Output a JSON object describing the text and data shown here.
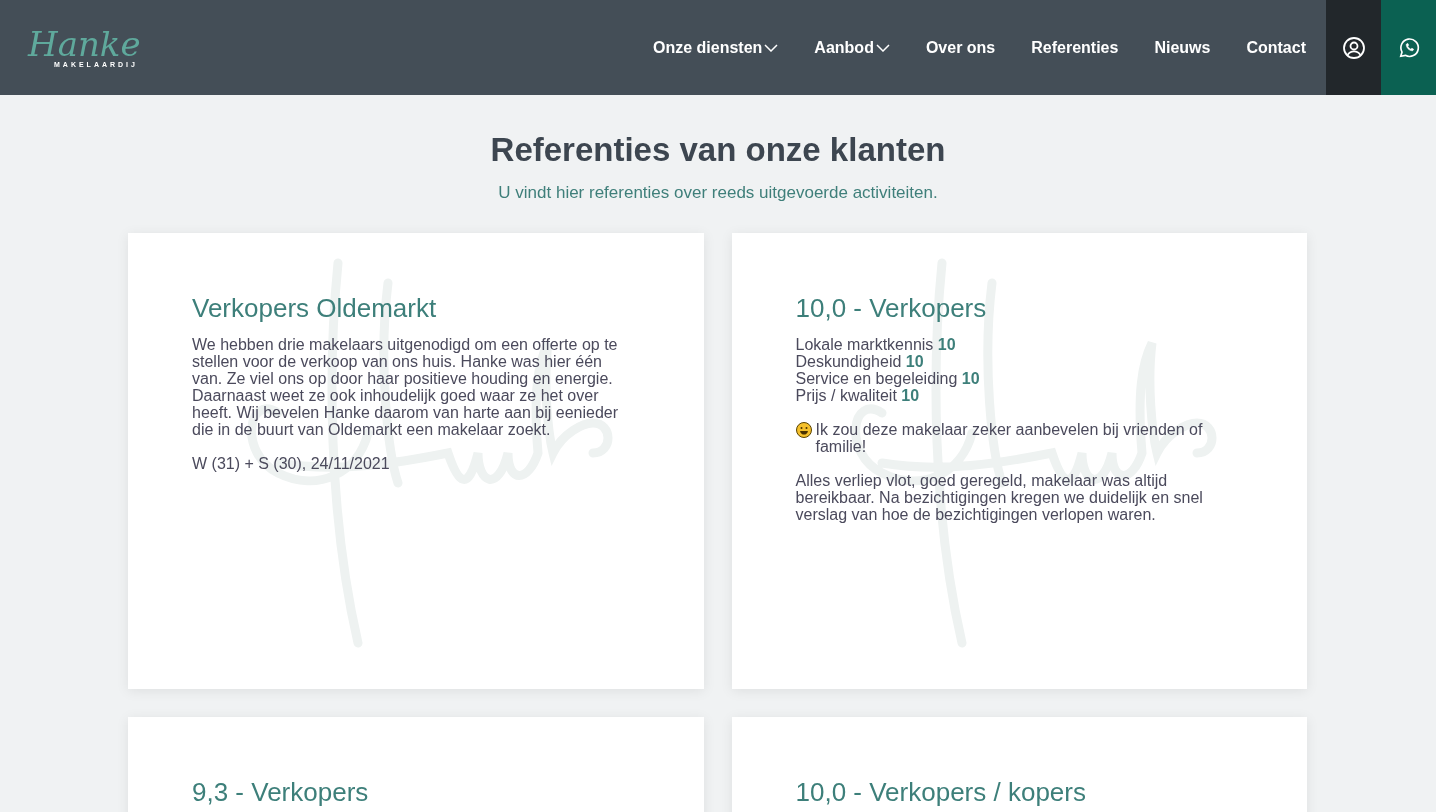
{
  "header": {
    "logo": {
      "script": "Hanke",
      "subtitle": "MAKELAARDIJ"
    },
    "nav": [
      {
        "label": "Onze diensten",
        "dropdown": true,
        "selected": false
      },
      {
        "label": "Aanbod",
        "dropdown": true,
        "selected": false
      },
      {
        "label": "Over ons",
        "dropdown": false,
        "selected": false
      },
      {
        "label": "Referenties",
        "dropdown": false,
        "selected": false
      },
      {
        "label": "Nieuws",
        "dropdown": false,
        "selected": false
      },
      {
        "label": "Contact",
        "dropdown": false,
        "selected": false
      }
    ]
  },
  "page": {
    "title": "Referenties van onze klanten",
    "subtitle": "U vindt hier referenties over reeds uitgevoerde activiteiten."
  },
  "cards": [
    {
      "title": "Verkopers Oldemarkt",
      "blocks": [
        {
          "kind": "text",
          "text": "We hebben drie makelaars uitgenodigd om een offerte op te stellen voor de verkoop van ons huis. Hanke was hier één van. Ze viel ons op door haar positieve houding en energie. Daarnaast weet ze ook inhoudelijk goed waar ze het over heeft. Wij bevelen Hanke daarom van harte aan bij eenieder die in de buurt van Oldemarkt een makelaar zoekt."
        },
        {
          "kind": "text",
          "text": "W (31) + S (30), 24/11/2021"
        }
      ]
    },
    {
      "title": "10,0 - Verkopers",
      "blocks": [
        {
          "kind": "ratings",
          "items": [
            {
              "label": "Lokale marktkennis",
              "score": "10"
            },
            {
              "label": "Deskundigheid",
              "score": "10"
            },
            {
              "label": "Service en begeleiding",
              "score": "10"
            },
            {
              "label": "Prijs / kwaliteit",
              "score": "10"
            }
          ]
        },
        {
          "kind": "recommend",
          "text": "Ik zou deze makelaar zeker aanbevelen bij vrienden of familie!"
        },
        {
          "kind": "text",
          "text": "Alles verliep vlot, goed geregeld, makelaar was altijd bereikbaar. Na bezichtigingen kregen we duidelijk en snel verslag van hoe de bezichtigingen verlopen waren."
        }
      ]
    },
    {
      "title": "9,3 - Verkopers"
    },
    {
      "title": "10,0 - Verkopers / kopers"
    }
  ]
}
